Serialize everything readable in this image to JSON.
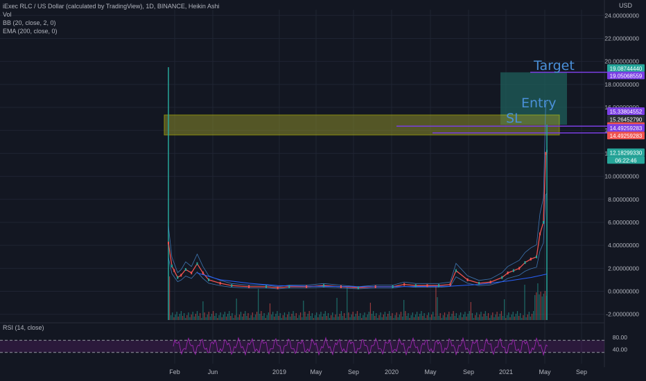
{
  "legend": {
    "title": "iExec RLC / US Dollar (calculated by TradingView), 1D, BINANCE, Heikin Ashi",
    "vol": "Vol",
    "bb": "BB (20, close, 2, 0)",
    "ema": "EMA (200, close, 0)",
    "rsi": "RSI (14, close)",
    "currency": "USD"
  },
  "annotations": {
    "target": "Target",
    "entry": "Entry",
    "sl": "SL"
  },
  "colors": {
    "background": "#131722",
    "grid": "#1f2433",
    "up": "#26a69a",
    "down": "#ef5350",
    "ema": "#2962ff",
    "bb_band": "#4a90d9",
    "rsi": "#9c27b0",
    "zone_fill": "#8a8a2a",
    "zone_border": "#e6e600",
    "target_box": "#1f5f5b",
    "annotation": "#4a90d9",
    "purple_line": "#7b3fe4"
  },
  "chart_data": {
    "type": "line",
    "title": "iExec RLC / US Dollar (calculated by TradingView), 1D, BINANCE, Heikin Ashi",
    "x_ticks": [
      "Feb",
      "Jun",
      "2019",
      "May",
      "Sep",
      "2020",
      "May",
      "Sep",
      "2021",
      "May",
      "Sep"
    ],
    "y_ticks": [
      24,
      22,
      20,
      18,
      16,
      14,
      12,
      10,
      8,
      6,
      4,
      2,
      0,
      -2
    ],
    "y_tick_labels": [
      "24.00000000",
      "22.00000000",
      "20.00000000",
      "18.00000000",
      "16.00000000",
      "14.00000000",
      "12.00000000",
      "10.00000000",
      "8.00000000",
      "6.00000000",
      "4.00000000",
      "2.00000000",
      "0.00000000",
      "-2.00000000"
    ],
    "ylim": [
      -2.5,
      24.5
    ],
    "xlim": [
      2018.0,
      2021.75
    ],
    "price_series": {
      "name": "RLC/USD",
      "x": [
        2018.05,
        2018.08,
        2018.1,
        2018.13,
        2018.16,
        2018.2,
        2018.25,
        2018.3,
        2018.35,
        2018.4,
        2018.5,
        2018.6,
        2018.75,
        2018.9,
        2019.0,
        2019.1,
        2019.25,
        2019.4,
        2019.55,
        2019.7,
        2019.85,
        2020.0,
        2020.1,
        2020.2,
        2020.3,
        2020.4,
        2020.5,
        2020.55,
        2020.65,
        2020.75,
        2020.85,
        2020.95,
        2021.0,
        2021.05,
        2021.1,
        2021.15,
        2021.2,
        2021.25,
        2021.28,
        2021.31,
        2021.33,
        2021.34
      ],
      "values": [
        4.2,
        2.2,
        1.8,
        1.2,
        1.4,
        1.9,
        1.6,
        2.4,
        1.6,
        1.0,
        0.7,
        0.5,
        0.4,
        0.4,
        0.3,
        0.4,
        0.4,
        0.5,
        0.4,
        0.3,
        0.4,
        0.4,
        0.6,
        0.5,
        0.5,
        0.5,
        0.6,
        1.8,
        1.0,
        0.7,
        0.8,
        1.2,
        1.6,
        1.8,
        2.0,
        2.5,
        2.8,
        3.0,
        5.0,
        6.0,
        12.0,
        12.18
      ]
    },
    "ema_series": {
      "name": "EMA",
      "x": [
        2018.3,
        2018.5,
        2018.75,
        2019.0,
        2019.25,
        2019.5,
        2019.75,
        2020.0,
        2020.25,
        2020.5,
        2020.75,
        2021.0,
        2021.2,
        2021.34
      ],
      "values": [
        1.6,
        1.0,
        0.7,
        0.5,
        0.45,
        0.42,
        0.4,
        0.4,
        0.42,
        0.45,
        0.6,
        0.9,
        1.2,
        1.5
      ]
    },
    "rsi": {
      "name": "RSI (14, close)",
      "levels": [
        70,
        30
      ],
      "y_tick_labels": [
        "80.00",
        "40.00"
      ],
      "ylim": [
        0,
        100
      ]
    },
    "price_labels": [
      {
        "value": "19.08744440",
        "color": "#26a69a"
      },
      {
        "value": "19.05068559",
        "color": "#7b3fe4"
      },
      {
        "value": "15.33804552",
        "color": "#7b3fe4"
      },
      {
        "value": "15.26452790",
        "color": "#2a2e39"
      },
      {
        "value": "14.63961552",
        "color": "#ef5350"
      },
      {
        "value": "14.49259283",
        "color": "#7b3fe4"
      },
      {
        "value": "14.49259283",
        "color": "#ef5350"
      },
      {
        "value": "12.18299330",
        "color": "#26a69a"
      },
      {
        "value": "06:22:46",
        "color": "#26a69a"
      }
    ]
  }
}
